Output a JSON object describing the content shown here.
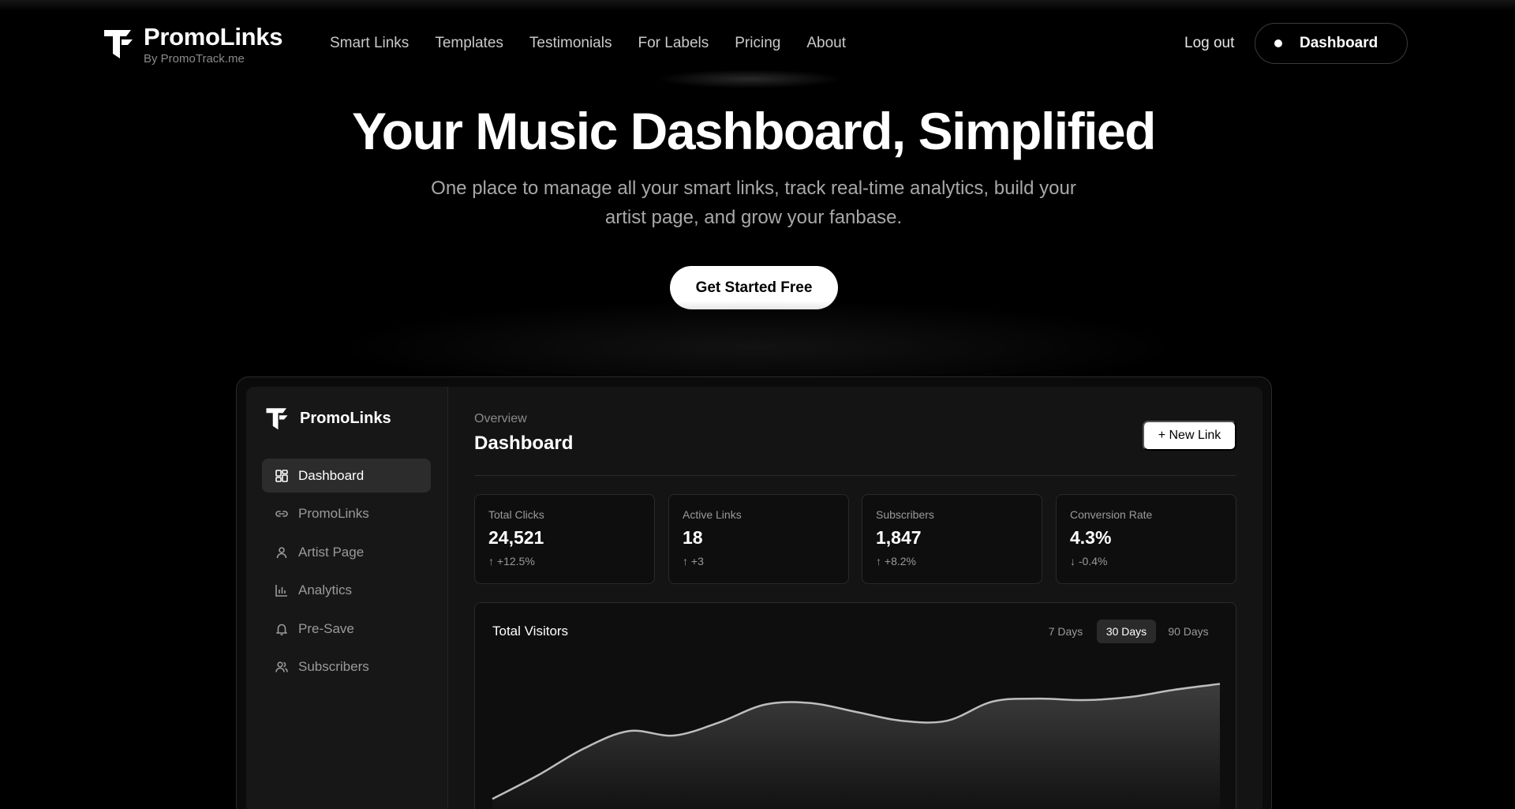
{
  "brand": {
    "name": "PromoLinks",
    "byline": "By PromoTrack.me"
  },
  "nav": {
    "items": [
      "Smart Links",
      "Templates",
      "Testimonials",
      "For Labels",
      "Pricing",
      "About"
    ],
    "logout": "Log out",
    "dashboard": "Dashboard"
  },
  "hero": {
    "title": "Your Music Dashboard, Simplified",
    "subtitle_line1": "One place to manage all your smart links, track real-time analytics, build your",
    "subtitle_line2": "artist page, and grow your fanbase.",
    "cta": "Get Started Free"
  },
  "app": {
    "brand": "PromoLinks",
    "sidebar": [
      {
        "label": "Dashboard",
        "icon": "grid-icon",
        "active": true
      },
      {
        "label": "PromoLinks",
        "icon": "link-icon",
        "active": false
      },
      {
        "label": "Artist Page",
        "icon": "user-icon",
        "active": false
      },
      {
        "label": "Analytics",
        "icon": "bar-chart-icon",
        "active": false
      },
      {
        "label": "Pre-Save",
        "icon": "bell-icon",
        "active": false
      },
      {
        "label": "Subscribers",
        "icon": "users-icon",
        "active": false
      }
    ],
    "breadcrumb": "Overview",
    "title": "Dashboard",
    "new_link": "+ New Link",
    "stats": [
      {
        "label": "Total Clicks",
        "value": "24,521",
        "delta": "↑ +12.5%"
      },
      {
        "label": "Active Links",
        "value": "18",
        "delta": "↑ +3"
      },
      {
        "label": "Subscribers",
        "value": "1,847",
        "delta": "↑ +8.2%"
      },
      {
        "label": "Conversion Rate",
        "value": "4.3%",
        "delta": "↓ -0.4%"
      }
    ],
    "chart": {
      "title": "Total Visitors",
      "ranges": [
        "7 Days",
        "30 Days",
        "90 Days"
      ],
      "selected_range": "30 Days"
    }
  },
  "colors": {
    "background": "#000000",
    "panel": "#141414",
    "accent": "#ffffff",
    "muted": "#9a9a9a"
  },
  "chart_data": {
    "type": "area",
    "title": "Total Visitors",
    "x": [
      0,
      1,
      2,
      3,
      4,
      5,
      6,
      7,
      8,
      9,
      10,
      11,
      12,
      13,
      14,
      15,
      16
    ],
    "values": [
      10,
      26,
      44,
      56,
      53,
      62,
      74,
      75,
      69,
      63,
      63,
      76,
      78,
      77,
      79,
      84,
      88
    ],
    "ylim": [
      0,
      100
    ],
    "grid": false,
    "legend": "none"
  }
}
